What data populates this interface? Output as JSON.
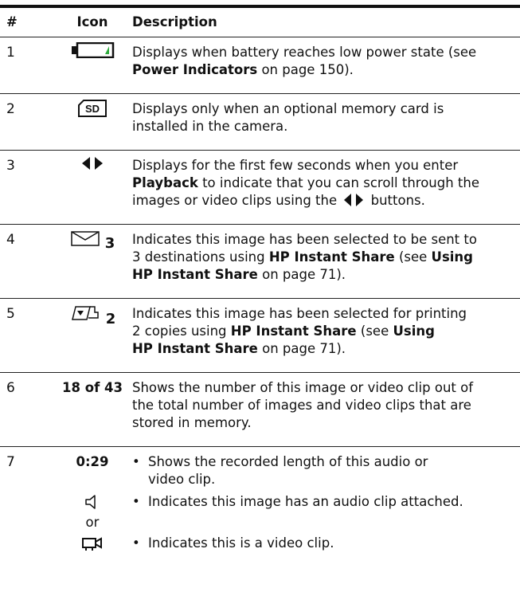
{
  "header": {
    "num": "#",
    "icon": "Icon",
    "description": "Description"
  },
  "rows": [
    {
      "num": "1",
      "icon": "battery-low-icon",
      "desc_lines": [
        {
          "parts": [
            {
              "t": "Displays when battery reaches low power state (see"
            }
          ]
        },
        {
          "parts": [
            {
              "t": "Power Indicators",
              "b": true
            },
            {
              "t": " on page 150)."
            }
          ]
        }
      ]
    },
    {
      "num": "2",
      "icon": "sd-card-icon",
      "desc_lines": [
        {
          "parts": [
            {
              "t": "Displays only when an optional memory card is"
            }
          ]
        },
        {
          "parts": [
            {
              "t": "installed in the camera."
            }
          ]
        }
      ]
    },
    {
      "num": "3",
      "icon": "scroll-arrows-icon",
      "desc_lines": [
        {
          "parts": [
            {
              "t": "Displays for the first few seconds when you enter"
            }
          ]
        },
        {
          "parts": [
            {
              "t": "Playback",
              "b": true
            },
            {
              "t": " to indicate that you can scroll through the"
            }
          ]
        },
        {
          "parts": [
            {
              "t": "images or video clips using the "
            },
            {
              "t": "◀▶",
              "arrow": true
            },
            {
              "t": " buttons."
            }
          ]
        }
      ]
    },
    {
      "num": "4",
      "icon": "envelope-icon",
      "icon_count": "3",
      "desc_lines": [
        {
          "parts": [
            {
              "t": "Indicates this image has been selected to be sent to"
            }
          ]
        },
        {
          "parts": [
            {
              "t": "3 destinations using "
            },
            {
              "t": "HP Instant Share",
              "b": true
            },
            {
              "t": " (see "
            },
            {
              "t": "Using",
              "b": true
            }
          ]
        },
        {
          "parts": [
            {
              "t": "HP Instant Share",
              "b": true
            },
            {
              "t": " on page 71)."
            }
          ]
        }
      ]
    },
    {
      "num": "5",
      "icon": "print-icon",
      "icon_count": "2",
      "desc_lines": [
        {
          "parts": [
            {
              "t": "Indicates this image has been selected for printing"
            }
          ]
        },
        {
          "parts": [
            {
              "t": "2 copies using "
            },
            {
              "t": "HP Instant Share",
              "b": true
            },
            {
              "t": " (see "
            },
            {
              "t": "Using",
              "b": true
            }
          ]
        },
        {
          "parts": [
            {
              "t": "HP Instant Share",
              "b": true
            },
            {
              "t": " on page 71)."
            }
          ]
        }
      ]
    },
    {
      "num": "6",
      "icon_text": "18 of 43",
      "desc_lines": [
        {
          "parts": [
            {
              "t": "Shows the number of this image or video clip out of"
            }
          ]
        },
        {
          "parts": [
            {
              "t": "the total number of images and video clips that are"
            }
          ]
        },
        {
          "parts": [
            {
              "t": "stored in memory."
            }
          ]
        }
      ]
    }
  ],
  "row7": {
    "num": "7",
    "time": "0:29",
    "or_text": "or",
    "bullets": [
      {
        "icon": "",
        "lines": [
          "Shows the recorded length of this audio or",
          "video clip."
        ]
      },
      {
        "icon": "speaker-icon",
        "lines": [
          "Indicates this image has an audio clip attached."
        ]
      },
      {
        "icon": "video-camera-icon",
        "lines": [
          "Indicates this is a video clip."
        ]
      }
    ],
    "bullet_char": "•"
  },
  "colors": {
    "text": "#111111",
    "battery_level": "#2eaa3c"
  }
}
